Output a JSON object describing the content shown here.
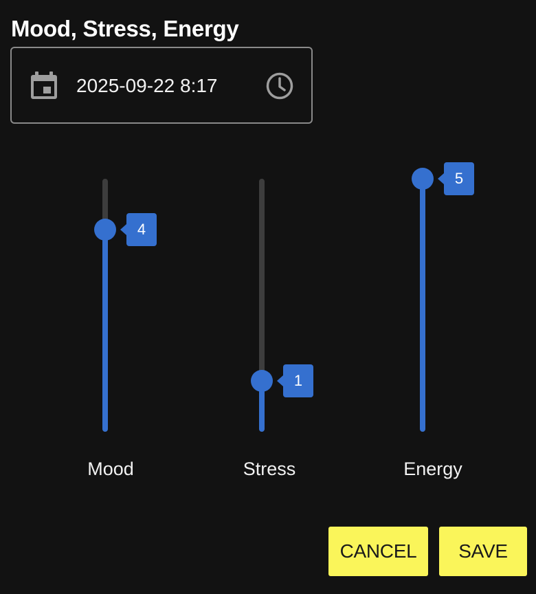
{
  "dialog": {
    "title": "Mood, Stress, Energy"
  },
  "datetime": {
    "value": "2025-09-22 8:17",
    "calendar_icon": "calendar-icon",
    "clock_icon": "clock-icon"
  },
  "sliders": [
    {
      "label": "Mood",
      "value": 4,
      "value_text": "4",
      "min": 0,
      "max": 5
    },
    {
      "label": "Stress",
      "value": 1,
      "value_text": "1",
      "min": 0,
      "max": 5
    },
    {
      "label": "Energy",
      "value": 5,
      "value_text": "5",
      "min": 0,
      "max": 5
    }
  ],
  "actions": {
    "cancel_label": "CANCEL",
    "save_label": "SAVE"
  },
  "colors": {
    "background": "#121212",
    "accent": "#3570cf",
    "track": "#3d3d3d",
    "button": "#faf55a"
  }
}
